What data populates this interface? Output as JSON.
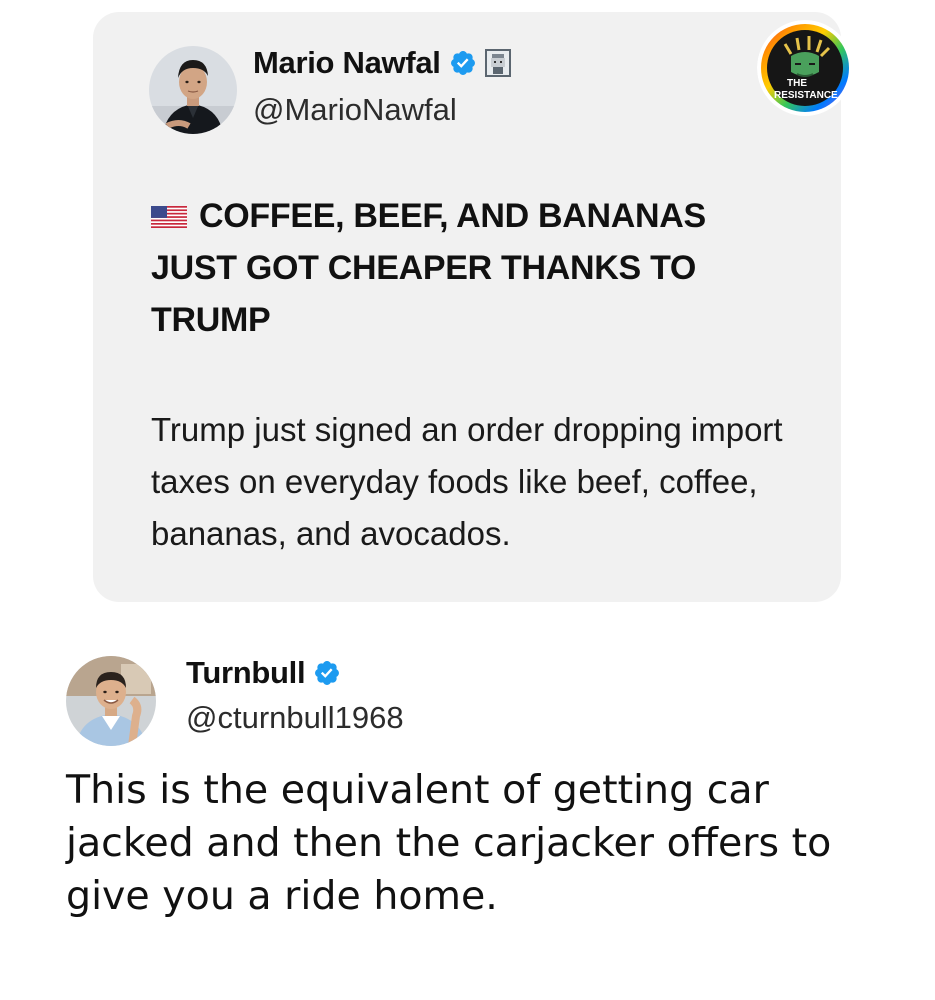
{
  "quoted_post": {
    "author_name": "Mario Nawfal",
    "author_handle": "@MarioNawfal",
    "verified": true,
    "headline": "COFFEE, BEEF, AND BANANAS JUST GOT CHEAPER THANKS TO TRUMP",
    "flag_icon": "us-flag-icon",
    "body": "Trump just signed an order dropping import taxes on everyday foods like beef, coffee, bananas, and avocados."
  },
  "watermark": {
    "line1": "THE",
    "line2": "RESISTANCE"
  },
  "reply_post": {
    "author_name": "Turnbull",
    "author_handle": "@cturnbull1968",
    "verified": true,
    "text": "This is the equivalent of getting car jacked and then the carjacker offers to give you a ride home."
  },
  "colors": {
    "verified_blue": "#1d9bf0",
    "card_background": "#f1f1f1"
  }
}
